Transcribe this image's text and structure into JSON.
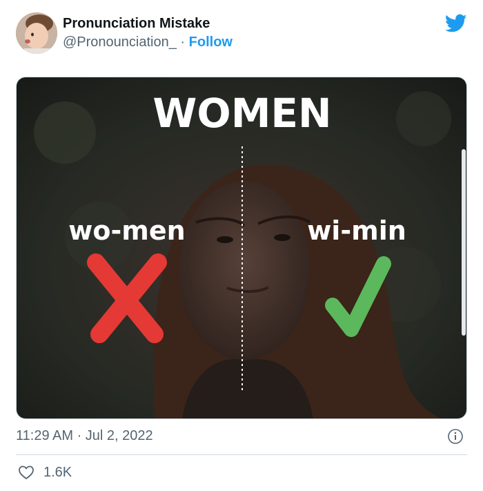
{
  "tweet": {
    "author_name": "Pronunciation Mistake",
    "handle": "@Pronounciation_",
    "separator": " · ",
    "follow_label": "Follow",
    "timestamp": "11:29 AM · Jul 2, 2022",
    "like_count": "1.6K"
  },
  "media": {
    "title": "WOMEN",
    "wrong_label": "wo-men",
    "right_label": "wi-min",
    "wrong_color": "#e53935",
    "right_color": "#5cb85c"
  },
  "icons": {
    "brand": "twitter-bird-icon",
    "info": "info-icon",
    "like": "heart-icon"
  },
  "colors": {
    "accent": "#1d9bf0",
    "muted_text": "#536471"
  }
}
